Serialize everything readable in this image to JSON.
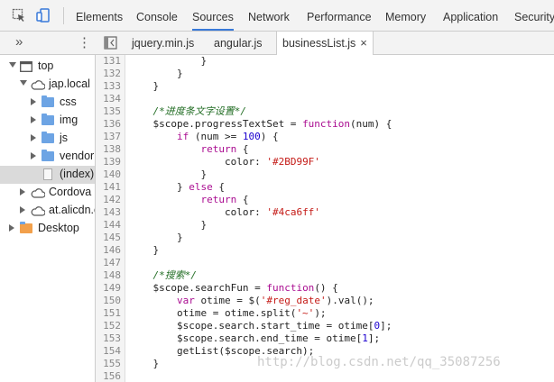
{
  "panel_tabs": [
    "Elements",
    "Console",
    "Sources",
    "Network",
    "Performance",
    "Memory",
    "Application",
    "Security"
  ],
  "active_panel": "Sources",
  "file_tabs": [
    "jquery.min.js",
    "angular.js",
    "businessList.js"
  ],
  "active_file": "businessList.js",
  "file_close_glyph": "×",
  "navigator_toggle": "»",
  "navigator_menu": "⋮",
  "tree": [
    {
      "label": "top",
      "icon": "frame-icon",
      "depth": 0,
      "expanded": true
    },
    {
      "label": "jap.local",
      "icon": "cloud-icon",
      "depth": 1,
      "expanded": true
    },
    {
      "label": "css",
      "icon": "folder-icon",
      "depth": 2,
      "expanded": false
    },
    {
      "label": "img",
      "icon": "folder-icon",
      "depth": 2,
      "expanded": false
    },
    {
      "label": "js",
      "icon": "folder-icon",
      "depth": 2,
      "expanded": false
    },
    {
      "label": "vendor",
      "icon": "folder-icon",
      "depth": 2,
      "expanded": false
    },
    {
      "label": "(index)",
      "icon": "file-icon",
      "depth": 2,
      "selected": true
    },
    {
      "label": "Cordova N",
      "icon": "cloud-icon",
      "depth": 1,
      "expanded": false
    },
    {
      "label": "at.alicdn.c",
      "icon": "cloud-icon",
      "depth": 1,
      "expanded": false
    },
    {
      "label": "Desktop",
      "icon": "folder-icon",
      "depth": 0,
      "expanded": false
    }
  ],
  "line_numbers": [
    "131",
    "132",
    "133",
    "134",
    "135",
    "136",
    "137",
    "138",
    "139",
    "140",
    "141",
    "142",
    "143",
    "144",
    "145",
    "146",
    "147",
    "148",
    "149",
    "150",
    "151",
    "152",
    "153",
    "154",
    "155",
    "156"
  ],
  "code_lines": [
    [
      {
        "t": "            }"
      }
    ],
    [
      {
        "t": "        }"
      }
    ],
    [
      {
        "t": "    }"
      }
    ],
    [
      {
        "t": ""
      }
    ],
    [
      {
        "t": "    "
      },
      {
        "t": "/*进度条文字设置*/",
        "c": "cm"
      }
    ],
    [
      {
        "t": "    $scope.progressTextSet = "
      },
      {
        "t": "function",
        "c": "kw"
      },
      {
        "t": "(num) {"
      }
    ],
    [
      {
        "t": "        "
      },
      {
        "t": "if",
        "c": "kw"
      },
      {
        "t": " (num >= "
      },
      {
        "t": "100",
        "c": "num"
      },
      {
        "t": ") {"
      }
    ],
    [
      {
        "t": "            "
      },
      {
        "t": "return",
        "c": "kw"
      },
      {
        "t": " {"
      }
    ],
    [
      {
        "t": "                color: "
      },
      {
        "t": "'#2BD99F'",
        "c": "str"
      }
    ],
    [
      {
        "t": "            }"
      }
    ],
    [
      {
        "t": "        } "
      },
      {
        "t": "else",
        "c": "kw"
      },
      {
        "t": " {"
      }
    ],
    [
      {
        "t": "            "
      },
      {
        "t": "return",
        "c": "kw"
      },
      {
        "t": " {"
      }
    ],
    [
      {
        "t": "                color: "
      },
      {
        "t": "'#4ca6ff'",
        "c": "str"
      }
    ],
    [
      {
        "t": "            }"
      }
    ],
    [
      {
        "t": "        }"
      }
    ],
    [
      {
        "t": "    }"
      }
    ],
    [
      {
        "t": ""
      }
    ],
    [
      {
        "t": "    "
      },
      {
        "t": "/*搜索*/",
        "c": "cm"
      }
    ],
    [
      {
        "t": "    $scope.searchFun = "
      },
      {
        "t": "function",
        "c": "kw"
      },
      {
        "t": "() {"
      }
    ],
    [
      {
        "t": "        "
      },
      {
        "t": "var",
        "c": "kw"
      },
      {
        "t": " otime = $("
      },
      {
        "t": "'#reg_date'",
        "c": "str"
      },
      {
        "t": ").val();"
      }
    ],
    [
      {
        "t": "        otime = otime.split("
      },
      {
        "t": "'~'",
        "c": "str"
      },
      {
        "t": ");"
      }
    ],
    [
      {
        "t": "        $scope.search.start_time = otime["
      },
      {
        "t": "0",
        "c": "num"
      },
      {
        "t": "];"
      }
    ],
    [
      {
        "t": "        $scope.search.end_time = otime["
      },
      {
        "t": "1",
        "c": "num"
      },
      {
        "t": "];"
      }
    ],
    [
      {
        "t": "        getList($scope.search);"
      }
    ],
    [
      {
        "t": "    }"
      }
    ],
    [
      {
        "t": ""
      }
    ]
  ],
  "watermark": "http://blog.csdn.net/qq_35087256"
}
